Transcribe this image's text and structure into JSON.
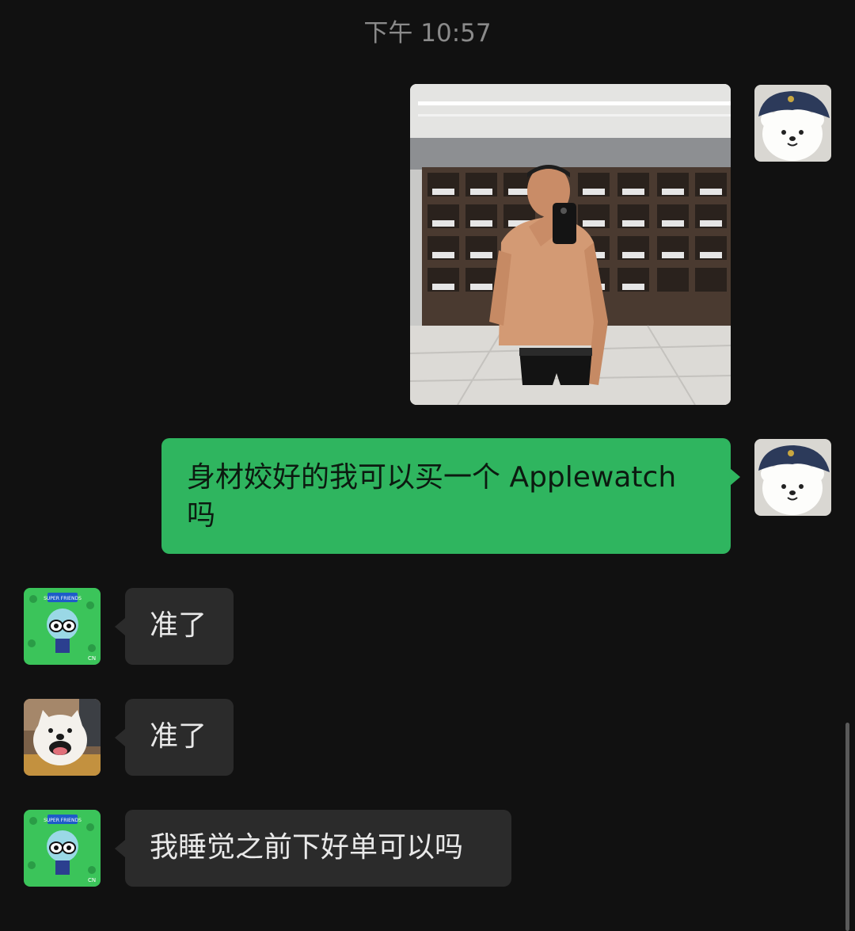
{
  "chat": {
    "timestamp": "下午 10:57",
    "messages": [
      {
        "sender": "me",
        "type": "image",
        "avatar": "bear-with-cap-icon"
      },
      {
        "sender": "me",
        "type": "text",
        "text": "身材姣好的我可以买一个 Applewatch 吗",
        "avatar": "bear-with-cap-icon"
      },
      {
        "sender": "contact-1",
        "type": "text",
        "text": "准了",
        "avatar": "cartoon-superhero-icon"
      },
      {
        "sender": "contact-2",
        "type": "text",
        "text": "准了",
        "avatar": "white-dog-icon"
      },
      {
        "sender": "contact-1",
        "type": "text",
        "text": "我睡觉之前下好单可以吗",
        "avatar": "cartoon-superhero-icon"
      }
    ],
    "avatar_badge_text": "SUPER FRIENDS",
    "avatar_corner_text": "CN"
  },
  "colors": {
    "background": "#111111",
    "outgoing_bubble": "#2fb55f",
    "incoming_bubble": "#2b2b2b",
    "timestamp_text": "#8a8a8a"
  }
}
